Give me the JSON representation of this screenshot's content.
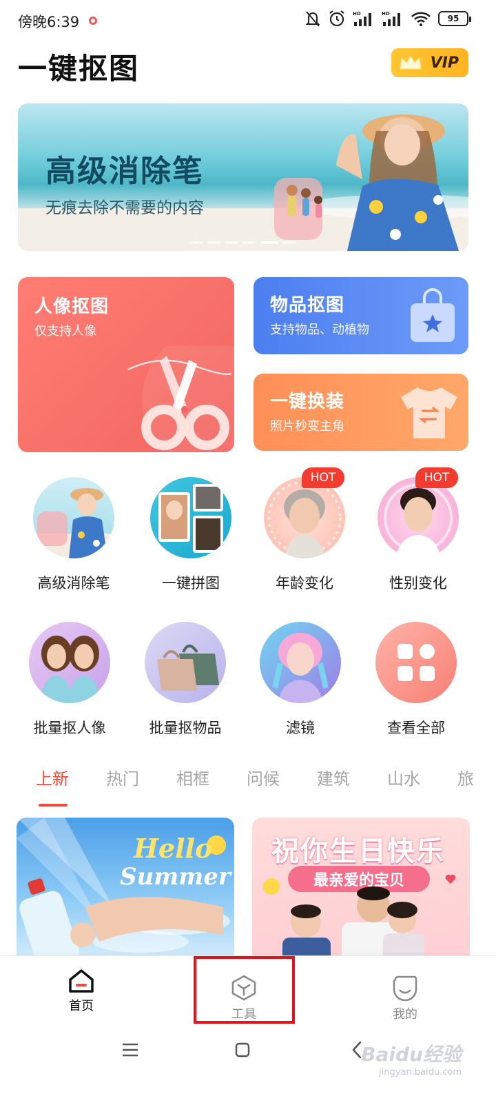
{
  "status_bar": {
    "time": "傍晚6:39",
    "battery": "95"
  },
  "header": {
    "title": "一键抠图",
    "vip_label": "VIP"
  },
  "banner": {
    "title": "高级消除笔",
    "subtitle": "无痕去除不需要的内容"
  },
  "cards": {
    "portrait": {
      "title": "人像抠图",
      "subtitle": "仅支持人像"
    },
    "object": {
      "title": "物品抠图",
      "subtitle": "支持物品、动植物"
    },
    "outfit": {
      "title": "一键换装",
      "subtitle": "照片秒变主角"
    }
  },
  "tools": [
    {
      "label": "高级消除笔"
    },
    {
      "label": "一键拼图"
    },
    {
      "label": "年龄变化",
      "badge": "HOT"
    },
    {
      "label": "性别变化",
      "badge": "HOT"
    },
    {
      "label": "批量抠人像"
    },
    {
      "label": "批量抠物品"
    },
    {
      "label": "滤镜"
    },
    {
      "label": "查看全部"
    }
  ],
  "categories": [
    "上新",
    "热门",
    "相框",
    "问候",
    "建筑",
    "山水",
    "旅"
  ],
  "templates": {
    "summer": {
      "line1": "Hello",
      "line2": "Summer"
    },
    "birthday": {
      "title": "祝你生日快乐",
      "subtitle": "最亲爱的宝贝"
    }
  },
  "bottom_nav": [
    {
      "label": "首页"
    },
    {
      "label": "工具"
    },
    {
      "label": "我的"
    }
  ],
  "watermark": {
    "brand": "Baidu经验",
    "url": "jingyan.baidu.com"
  },
  "colors": {
    "accent": "#f04a3c",
    "highlight": "#e4141a",
    "vip": "#ffc633"
  }
}
